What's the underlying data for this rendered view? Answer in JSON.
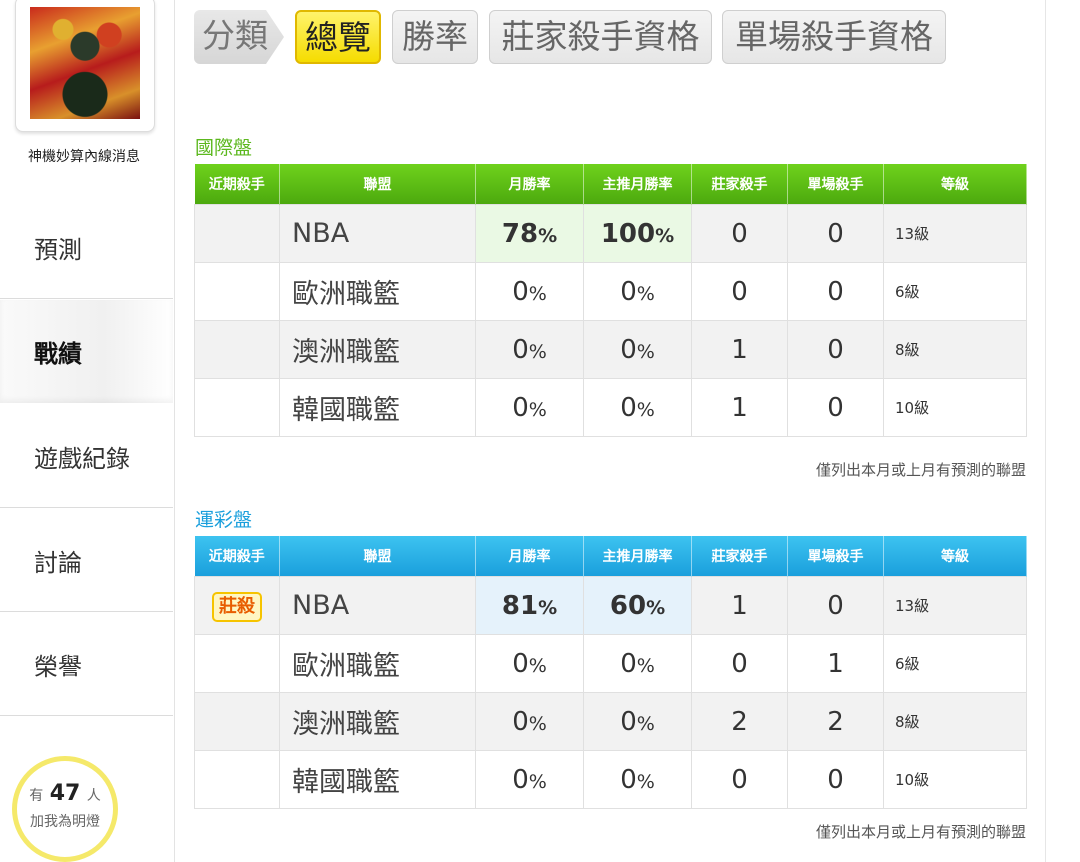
{
  "sidebar": {
    "profile_name": "神機妙算內線消息",
    "items": [
      {
        "label": "預測"
      },
      {
        "label": "戰績"
      },
      {
        "label": "遊戲紀錄"
      },
      {
        "label": "討論"
      },
      {
        "label": "榮譽"
      }
    ],
    "fans": {
      "prefix": "有",
      "count": "47",
      "suffix": "人",
      "caption": "加我為明燈"
    }
  },
  "tabs": {
    "category": "分類",
    "items": [
      {
        "label": "總覽"
      },
      {
        "label": "勝率"
      },
      {
        "label": "莊家殺手資格"
      },
      {
        "label": "單場殺手資格"
      }
    ]
  },
  "columns": [
    "近期殺手",
    "聯盟",
    "月勝率",
    "主推月勝率",
    "莊家殺手",
    "單場殺手",
    "等級"
  ],
  "international": {
    "title": "國際盤",
    "accent": "#5cb81e",
    "rows": [
      {
        "badge": "",
        "league": "NBA",
        "month_rate": "78",
        "main_rate": "100",
        "banker": "0",
        "single": "0",
        "level": "13級"
      },
      {
        "badge": "",
        "league": "歐洲職籃",
        "month_rate": "0",
        "main_rate": "0",
        "banker": "0",
        "single": "0",
        "level": "6級"
      },
      {
        "badge": "",
        "league": "澳洲職籃",
        "month_rate": "0",
        "main_rate": "0",
        "banker": "1",
        "single": "0",
        "level": "8級"
      },
      {
        "badge": "",
        "league": "韓國職籃",
        "month_rate": "0",
        "main_rate": "0",
        "banker": "1",
        "single": "0",
        "level": "10級"
      }
    ],
    "note": "僅列出本月或上月有預測的聯盟"
  },
  "sports_lottery": {
    "title": "運彩盤",
    "accent": "#1a9fdc",
    "rows": [
      {
        "badge": "莊殺",
        "league": "NBA",
        "month_rate": "81",
        "main_rate": "60",
        "banker": "1",
        "single": "0",
        "level": "13級"
      },
      {
        "badge": "",
        "league": "歐洲職籃",
        "month_rate": "0",
        "main_rate": "0",
        "banker": "0",
        "single": "1",
        "level": "6級"
      },
      {
        "badge": "",
        "league": "澳洲職籃",
        "month_rate": "0",
        "main_rate": "0",
        "banker": "2",
        "single": "2",
        "level": "8級"
      },
      {
        "badge": "",
        "league": "韓國職籃",
        "month_rate": "0",
        "main_rate": "0",
        "banker": "0",
        "single": "0",
        "level": "10級"
      }
    ],
    "note": "僅列出本月或上月有預測的聯盟"
  },
  "pct_symbol": "%"
}
